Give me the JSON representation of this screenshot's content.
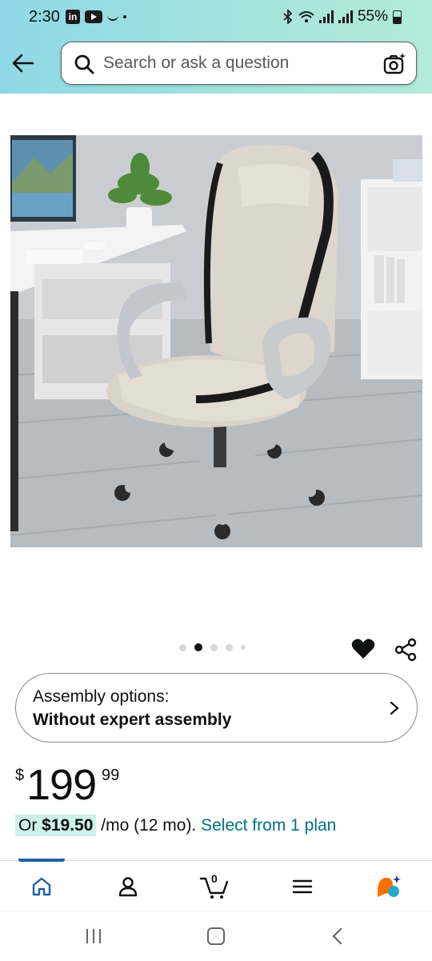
{
  "status_bar": {
    "time": "2:30",
    "linkedin_label": "in",
    "battery": "55%"
  },
  "search": {
    "placeholder": "Search or ask a question"
  },
  "gallery": {
    "image_count": 5,
    "active_index": 1
  },
  "assembly": {
    "label": "Assembly options:",
    "value": "Without expert assembly"
  },
  "price": {
    "symbol": "$",
    "whole": "199",
    "fraction": "99"
  },
  "monthly": {
    "highlight_prefix": "Or ",
    "highlight_amount": "$19.50",
    "suffix": " /mo (12 mo). ",
    "link": "Select from 1 plan"
  },
  "bottom_nav": {
    "cart_count": "0",
    "items": [
      "home-icon",
      "account-icon",
      "cart-icon",
      "menu-icon",
      "rufus-icon"
    ]
  },
  "colors": {
    "accent_link": "#007185",
    "nav_indicator": "#2162a1",
    "highlight_bg": "#ccf2ea"
  }
}
